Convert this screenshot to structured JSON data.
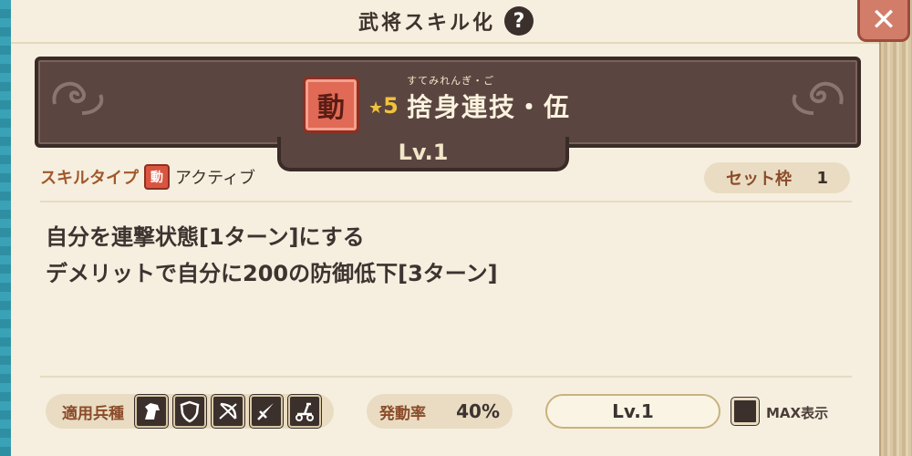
{
  "header": {
    "title": "武将スキル化",
    "help_icon": "?",
    "close_icon": "✕"
  },
  "skill": {
    "badge": "動",
    "star": "★",
    "rank": "5",
    "ruby": "すてみれんぎ・ご",
    "name": "捨身連技・伍",
    "level": "Lv.1"
  },
  "type_row": {
    "label": "スキルタイプ",
    "badge": "動",
    "value": "アクティブ"
  },
  "set_slot": {
    "label": "セット枠",
    "value": "1"
  },
  "description": {
    "line1": "自分を連撃状態[1ターン]にする",
    "line2": "デメリットで自分に200の防御低下[3ターン]"
  },
  "bottom": {
    "troop_label": "適用兵種",
    "troop_icons": [
      "horse-icon",
      "shield-icon",
      "bow-icon",
      "sword-icon",
      "catapult-icon"
    ],
    "rate_label": "発動率",
    "rate_value": "40%",
    "level_select": "Lv.1",
    "max_label": "MAX表示"
  }
}
